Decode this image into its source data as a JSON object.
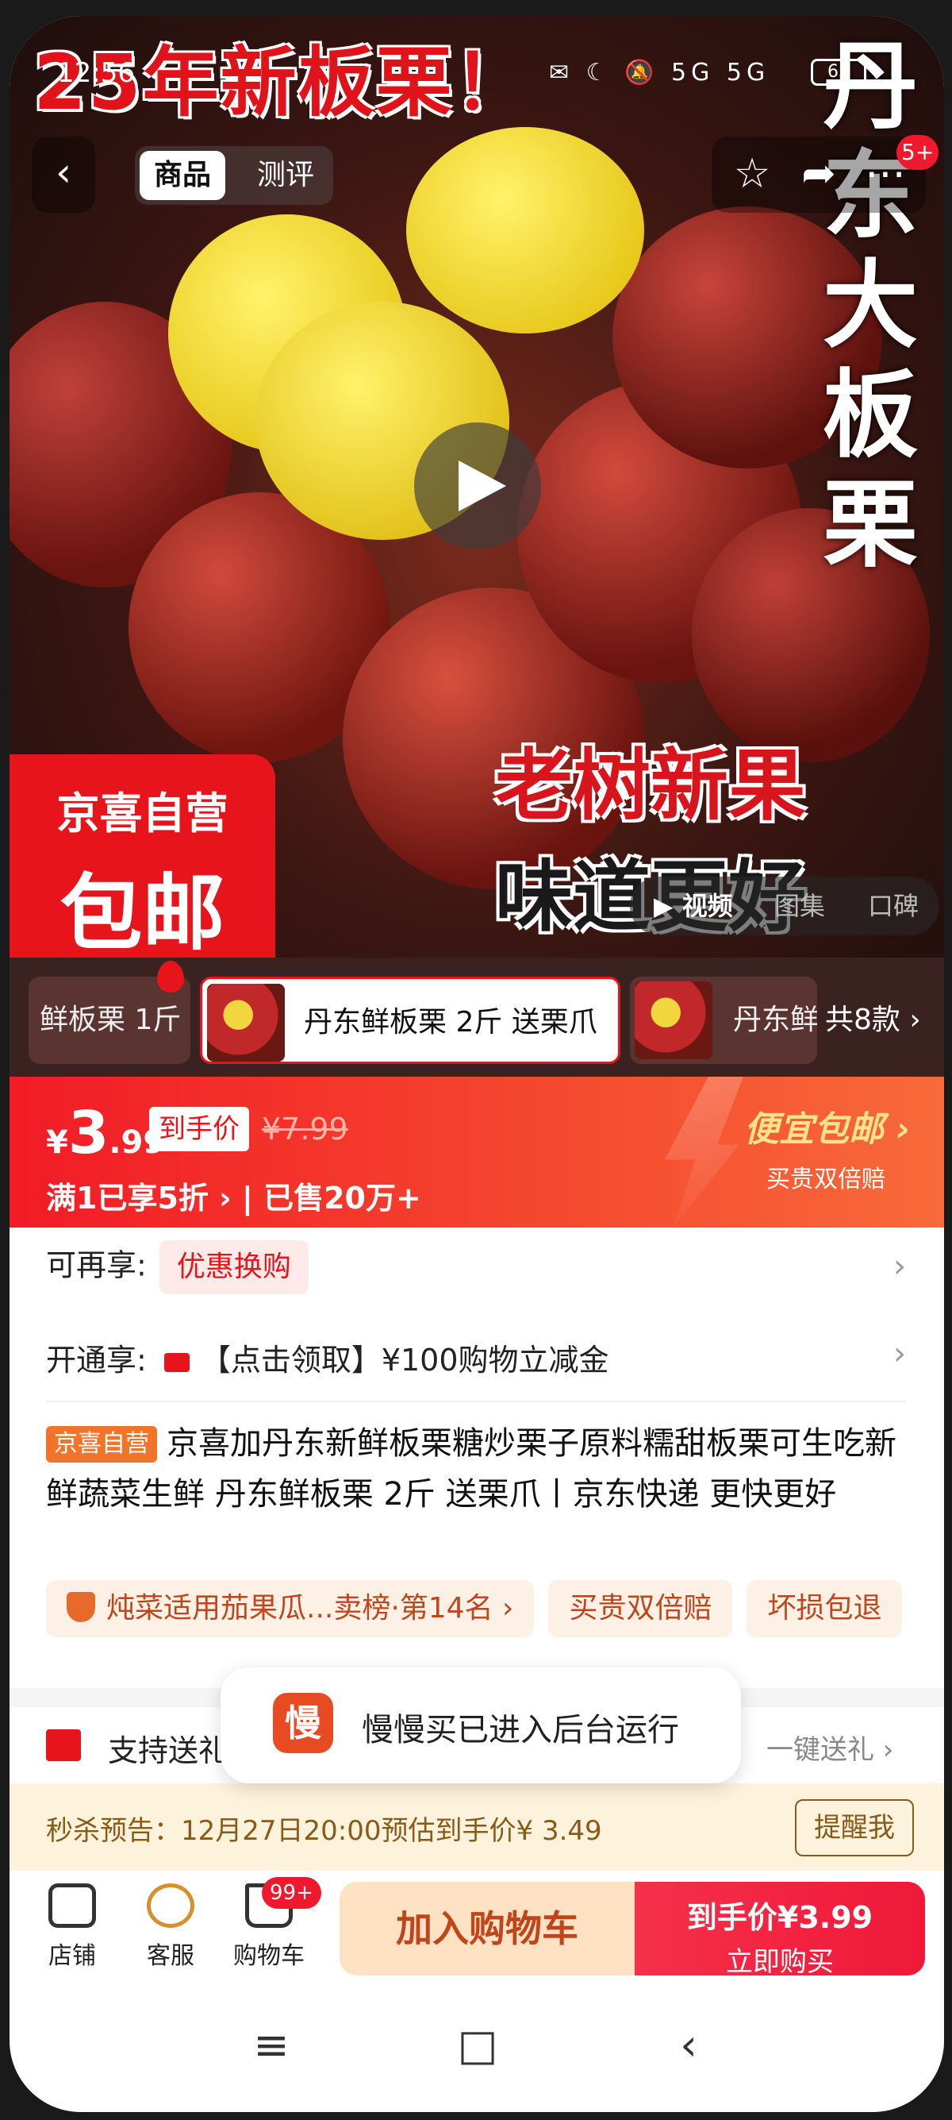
{
  "status_bar": {
    "time": "12:56",
    "icons": "✉ ☾ 🔕 5G 5G",
    "battery": "65"
  },
  "hero": {
    "title": "25年新板栗！",
    "vertical_title": "丹东大板栗",
    "slogan_line1": "老树新果",
    "slogan_line2": "味道更好",
    "badge_line1": "京喜自营",
    "badge_line2": "包邮"
  },
  "top_nav": {
    "tab_active": "商品",
    "tab_inactive": "测评",
    "message_count": "5+"
  },
  "media_tabs": [
    "视频",
    "图集",
    "口碑"
  ],
  "variants": {
    "items": [
      "鲜板栗 1斤",
      "丹东鲜板栗 2斤 送栗爪",
      "丹东鲜"
    ],
    "count_label": "共8款"
  },
  "price": {
    "currency": "¥",
    "integer": "3",
    "decimal": ".99",
    "to_hand_label": "到手价",
    "original": "¥7.99",
    "promo": "满1已享5折 › | 已售20万+",
    "cheap_label": "便宜包邮 ›",
    "cheap_sub": "买贵双倍赔"
  },
  "info": {
    "enjoy_label": "可再享:",
    "enjoy_tag": "优惠换购",
    "open_label": "开通享:",
    "open_text": "【点击领取】¥100购物立减金",
    "self_tag": "京喜自营",
    "title": "京喜加丹东新鲜板栗糖炒栗子原料糯甜板栗可生吃新鲜蔬菜生鲜 丹东鲜板栗 2斤 送栗爪丨京东快递 更快更好",
    "tags": [
      "炖菜适用茄果瓜...卖榜·第14名 ›",
      "买贵双倍赔",
      "坏损包退"
    ]
  },
  "gift": {
    "label": "支持送礼",
    "right": "一键送礼 ›"
  },
  "seckill": {
    "text": "秒杀预告：12月27日20:00预估到手价¥ 3.49",
    "button": "提醒我"
  },
  "bottom_bar": {
    "store": "店铺",
    "service": "客服",
    "cart": "购物车",
    "cart_badge": "99+",
    "add_to_cart": "加入购物车",
    "buy_line1": "到手价¥3.99",
    "buy_line2": "立即购买"
  },
  "toast": {
    "icon_text": "慢",
    "text": "慢慢买已进入后台运行"
  },
  "colors": {
    "brand_red": "#e8141c",
    "seckill_bg": "#fdf3dd",
    "add_cart_bg": "#ffe2c4"
  }
}
